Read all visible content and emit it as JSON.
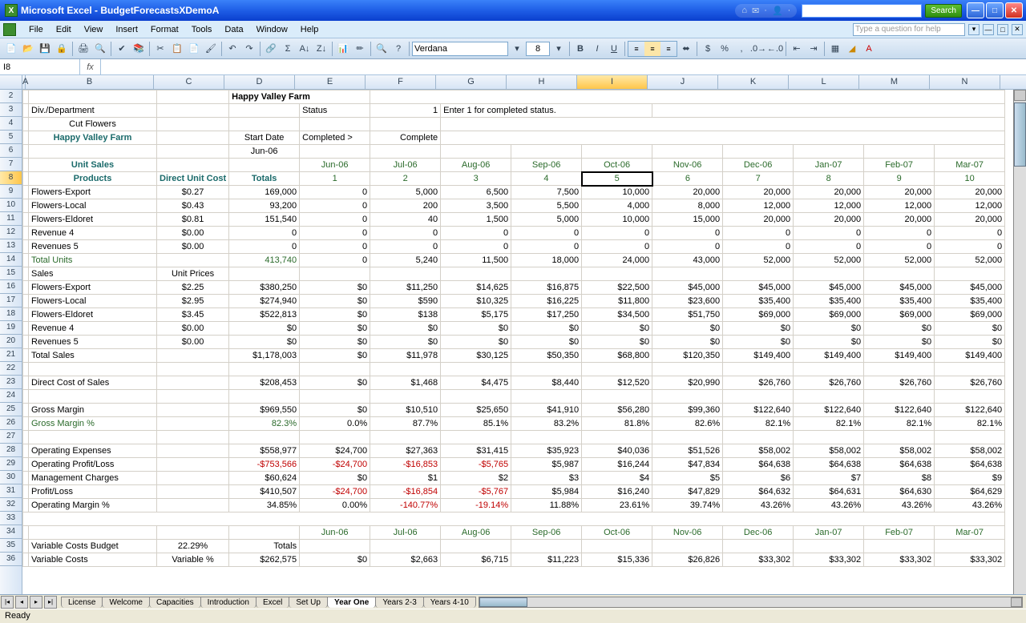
{
  "app": {
    "title": "Microsoft Excel - BudgetForecastsXDemoA"
  },
  "search": {
    "placeholder": "",
    "button": "Search"
  },
  "menus": [
    "File",
    "Edit",
    "View",
    "Insert",
    "Format",
    "Tools",
    "Data",
    "Window",
    "Help"
  ],
  "helpbox": {
    "placeholder": "Type a question for help"
  },
  "toolbar": {
    "font": "Verdana",
    "size": "8"
  },
  "namebox": "I8",
  "columns": [
    "A",
    "B",
    "C",
    "D",
    "E",
    "F",
    "G",
    "H",
    "I",
    "J",
    "K",
    "L",
    "M",
    "N"
  ],
  "col_selected": "I",
  "rows_count": 36,
  "row_selected": 8,
  "header_area": {
    "company": "Happy Valley Farm",
    "div_dept_label": "Div./Department",
    "subdept": "Cut Flowers",
    "company2": "Happy Valley Farm",
    "status_label": "Status",
    "status_value": "1",
    "status_help": "Enter 1 for completed status.",
    "start_date_label": "Start Date",
    "completed_label": "Completed >",
    "complete": "Complete",
    "start_month": "Jun-06"
  },
  "col_headers": {
    "unit_sales": "Unit Sales",
    "products": "Products",
    "direct_unit": "Direct Unit Cost",
    "totals": "Totals",
    "months": [
      "Jun-06",
      "Jul-06",
      "Aug-06",
      "Sep-06",
      "Oct-06",
      "Nov-06",
      "Dec-06",
      "Jan-07",
      "Feb-07",
      "Mar-07"
    ],
    "nums": [
      "1",
      "2",
      "3",
      "4",
      "5",
      "6",
      "7",
      "8",
      "9",
      "10"
    ]
  },
  "rows": {
    "9": [
      "Flowers-Export",
      "$0.27",
      "169,000",
      "0",
      "5,000",
      "6,500",
      "7,500",
      "10,000",
      "20,000",
      "20,000",
      "20,000",
      "20,000",
      "20,000"
    ],
    "10": [
      "Flowers-Local",
      "$0.43",
      "93,200",
      "0",
      "200",
      "3,500",
      "5,500",
      "4,000",
      "8,000",
      "12,000",
      "12,000",
      "12,000",
      "12,000"
    ],
    "11": [
      "Flowers-Eldoret",
      "$0.81",
      "151,540",
      "0",
      "40",
      "1,500",
      "5,000",
      "10,000",
      "15,000",
      "20,000",
      "20,000",
      "20,000",
      "20,000"
    ],
    "12": [
      "Revenue 4",
      "$0.00",
      "0",
      "0",
      "0",
      "0",
      "0",
      "0",
      "0",
      "0",
      "0",
      "0",
      "0"
    ],
    "13": [
      "Revenues 5",
      "$0.00",
      "0",
      "0",
      "0",
      "0",
      "0",
      "0",
      "0",
      "0",
      "0",
      "0",
      "0"
    ],
    "14": [
      "Total Units",
      "",
      "413,740",
      "0",
      "5,240",
      "11,500",
      "18,000",
      "24,000",
      "43,000",
      "52,000",
      "52,000",
      "52,000",
      "52,000"
    ],
    "15": [
      "Sales",
      "Unit Prices",
      "",
      "",
      "",
      "",
      "",
      "",
      "",
      "",
      "",
      "",
      ""
    ],
    "16": [
      "Flowers-Export",
      "$2.25",
      "$380,250",
      "$0",
      "$11,250",
      "$14,625",
      "$16,875",
      "$22,500",
      "$45,000",
      "$45,000",
      "$45,000",
      "$45,000",
      "$45,000"
    ],
    "17": [
      "Flowers-Local",
      "$2.95",
      "$274,940",
      "$0",
      "$590",
      "$10,325",
      "$16,225",
      "$11,800",
      "$23,600",
      "$35,400",
      "$35,400",
      "$35,400",
      "$35,400"
    ],
    "18": [
      "Flowers-Eldoret",
      "$3.45",
      "$522,813",
      "$0",
      "$138",
      "$5,175",
      "$17,250",
      "$34,500",
      "$51,750",
      "$69,000",
      "$69,000",
      "$69,000",
      "$69,000"
    ],
    "19": [
      "Revenue 4",
      "$0.00",
      "$0",
      "$0",
      "$0",
      "$0",
      "$0",
      "$0",
      "$0",
      "$0",
      "$0",
      "$0",
      "$0"
    ],
    "20": [
      "Revenues 5",
      "$0.00",
      "$0",
      "$0",
      "$0",
      "$0",
      "$0",
      "$0",
      "$0",
      "$0",
      "$0",
      "$0",
      "$0"
    ],
    "21": [
      "Total Sales",
      "",
      "$1,178,003",
      "$0",
      "$11,978",
      "$30,125",
      "$50,350",
      "$68,800",
      "$120,350",
      "$149,400",
      "$149,400",
      "$149,400",
      "$149,400"
    ],
    "22": [
      "",
      "",
      "",
      "",
      "",
      "",
      "",
      "",
      "",
      "",
      "",
      "",
      ""
    ],
    "23": [
      "Direct Cost of Sales",
      "",
      "$208,453",
      "$0",
      "$1,468",
      "$4,475",
      "$8,440",
      "$12,520",
      "$20,990",
      "$26,760",
      "$26,760",
      "$26,760",
      "$26,760"
    ],
    "24": [
      "",
      "",
      "",
      "",
      "",
      "",
      "",
      "",
      "",
      "",
      "",
      "",
      ""
    ],
    "25": [
      "Gross Margin",
      "",
      "$969,550",
      "$0",
      "$10,510",
      "$25,650",
      "$41,910",
      "$56,280",
      "$99,360",
      "$122,640",
      "$122,640",
      "$122,640",
      "$122,640"
    ],
    "26": [
      "Gross Margin %",
      "",
      "82.3%",
      "0.0%",
      "87.7%",
      "85.1%",
      "83.2%",
      "81.8%",
      "82.6%",
      "82.1%",
      "82.1%",
      "82.1%",
      "82.1%"
    ],
    "27": [
      "",
      "",
      "",
      "",
      "",
      "",
      "",
      "",
      "",
      "",
      "",
      "",
      ""
    ],
    "28": [
      "Operating Expenses",
      "",
      "$558,977",
      "$24,700",
      "$27,363",
      "$31,415",
      "$35,923",
      "$40,036",
      "$51,526",
      "$58,002",
      "$58,002",
      "$58,002",
      "$58,002"
    ],
    "29": [
      "Operating Profit/Loss",
      "",
      "-$753,566",
      "-$24,700",
      "-$16,853",
      "-$5,765",
      "$5,987",
      "$16,244",
      "$47,834",
      "$64,638",
      "$64,638",
      "$64,638",
      "$64,638"
    ],
    "30": [
      "Management Charges",
      "",
      "$60,624",
      "$0",
      "$1",
      "$2",
      "$3",
      "$4",
      "$5",
      "$6",
      "$7",
      "$8",
      "$9"
    ],
    "31": [
      "Profit/Loss",
      "",
      "$410,507",
      "-$24,700",
      "-$16,854",
      "-$5,767",
      "$5,984",
      "$16,240",
      "$47,829",
      "$64,632",
      "$64,631",
      "$64,630",
      "$64,629"
    ],
    "32": [
      "Operating Margin %",
      "",
      "34.85%",
      "0.00%",
      "-140.77%",
      "-19.14%",
      "11.88%",
      "23.61%",
      "39.74%",
      "43.26%",
      "43.26%",
      "43.26%",
      "43.26%"
    ],
    "33": [
      "",
      "",
      "",
      "",
      "",
      "",
      "",
      "",
      "",
      "",
      "",
      "",
      ""
    ],
    "34": [
      "",
      "",
      "",
      "Jun-06",
      "Jul-06",
      "Aug-06",
      "Sep-06",
      "Oct-06",
      "Nov-06",
      "Dec-06",
      "Jan-07",
      "Feb-07",
      "Mar-07"
    ],
    "35": [
      "Variable Costs Budget",
      "22.29%",
      "Totals",
      "",
      "",
      "",
      "",
      "",
      "",
      "",
      "",
      "",
      ""
    ],
    "36": [
      "Variable Costs",
      "Variable %",
      "$262,575",
      "$0",
      "$2,663",
      "$6,715",
      "$11,223",
      "$15,336",
      "$26,826",
      "$33,302",
      "$33,302",
      "$33,302",
      "$33,302"
    ]
  },
  "negatives": {
    "29": [
      2,
      3,
      4,
      5
    ],
    "31": [
      3,
      4,
      5
    ],
    "32": [
      4,
      5
    ]
  },
  "tabs": [
    "License",
    "Welcome",
    "Capacities",
    "Introduction",
    "Excel",
    "Set Up",
    "Year One",
    "Years 2-3",
    "Years 4-10"
  ],
  "active_tab": "Year One",
  "status": "Ready"
}
